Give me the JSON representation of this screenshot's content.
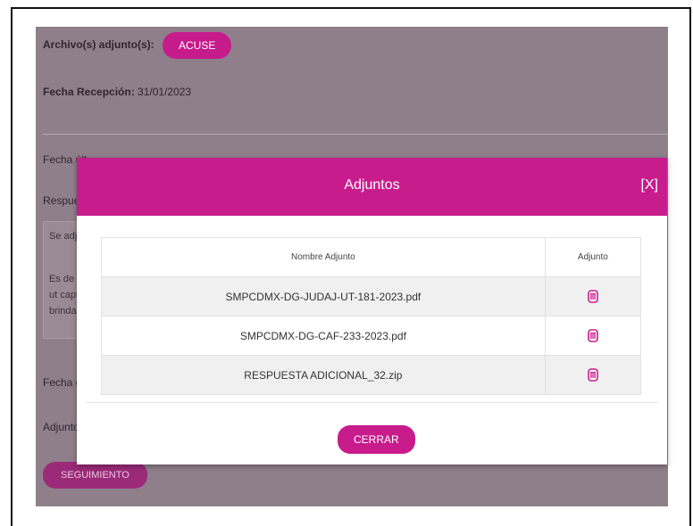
{
  "background": {
    "archivo_label": "Archivo(s) adjunto(s):",
    "acuse_button": "ACUSE",
    "fecha_recepcion_label": "Fecha Recepción:",
    "fecha_recepcion_value": "31/01/2023",
    "fecha_ultima_label": "Fecha últ",
    "respuesta_label": "Respues",
    "text_line1": "Se adju",
    "text_line2": "Es de s",
    "text_line3": "ut capt",
    "text_line4": "brindar",
    "fecha_en_label": "Fecha en",
    "adjunto_label": "Adjunto",
    "seguimiento_button": "SEGUIMIENTO"
  },
  "modal": {
    "title": "Adjuntos",
    "close_label": "[X]",
    "columns": [
      "Nombre Adjunto",
      "Adjunto"
    ],
    "rows": [
      {
        "name": "SMPCDMX-DG-JUDAJ-UT-181-2023.pdf",
        "icon": "file-icon"
      },
      {
        "name": "SMPCDMX-DG-CAF-233-2023.pdf",
        "icon": "file-icon"
      },
      {
        "name": "RESPUESTA ADICIONAL_32.zip",
        "icon": "file-icon"
      }
    ],
    "close_button": "CERRAR"
  },
  "colors": {
    "accent": "#c81c8d",
    "overlay": "#8f7f8b"
  }
}
